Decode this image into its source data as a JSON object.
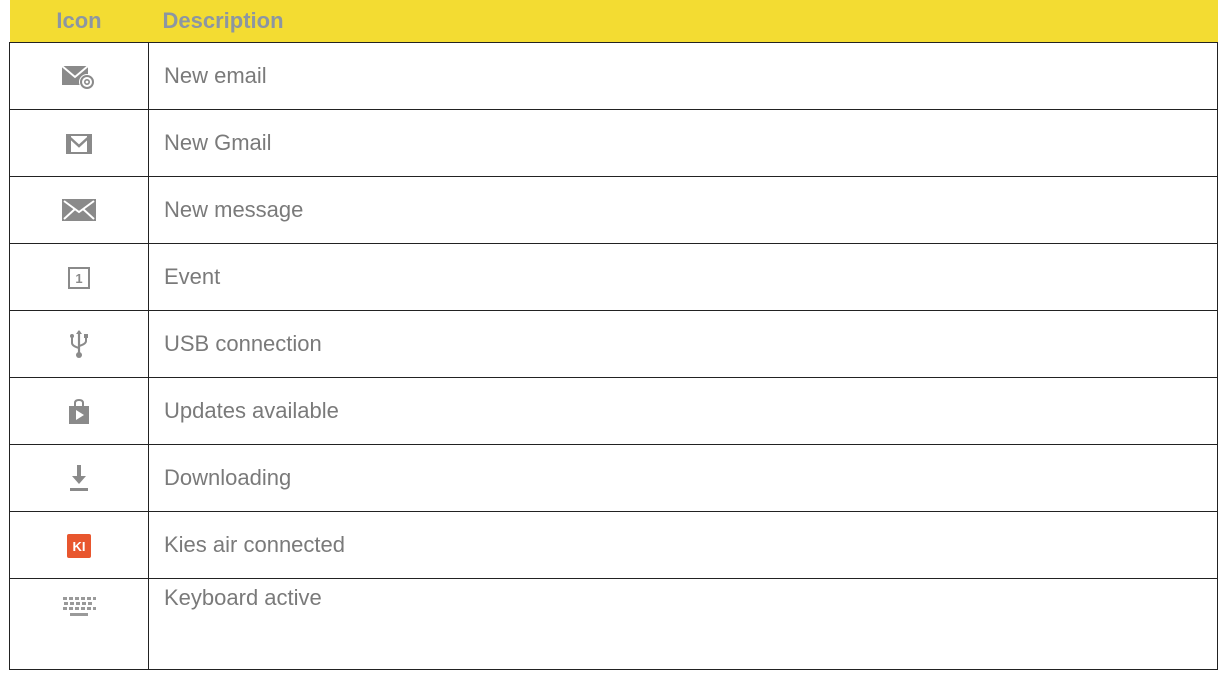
{
  "header": {
    "icon_label": "Icon",
    "description_label": "Description"
  },
  "colors": {
    "header_background": "#F3DC32",
    "header_text": "#8C96A2",
    "body_text": "#7A7A7A",
    "icon_gray": "#8A8A8A",
    "kies_orange": "#E8562E"
  },
  "rows": [
    {
      "icon": "email-at-icon",
      "label": "New email"
    },
    {
      "icon": "gmail-icon",
      "label": "New Gmail"
    },
    {
      "icon": "envelope-icon",
      "label": "New message"
    },
    {
      "icon": "calendar-event-icon",
      "label": "Event",
      "icon_text": "1"
    },
    {
      "icon": "usb-icon",
      "label": "USB connection"
    },
    {
      "icon": "play-store-bag-icon",
      "label": "Updates available"
    },
    {
      "icon": "download-icon",
      "label": "Downloading"
    },
    {
      "icon": "kies-air-icon",
      "label": "Kies air connected",
      "icon_text": "KI"
    },
    {
      "icon": "keyboard-icon",
      "label": "Keyboard active"
    }
  ]
}
